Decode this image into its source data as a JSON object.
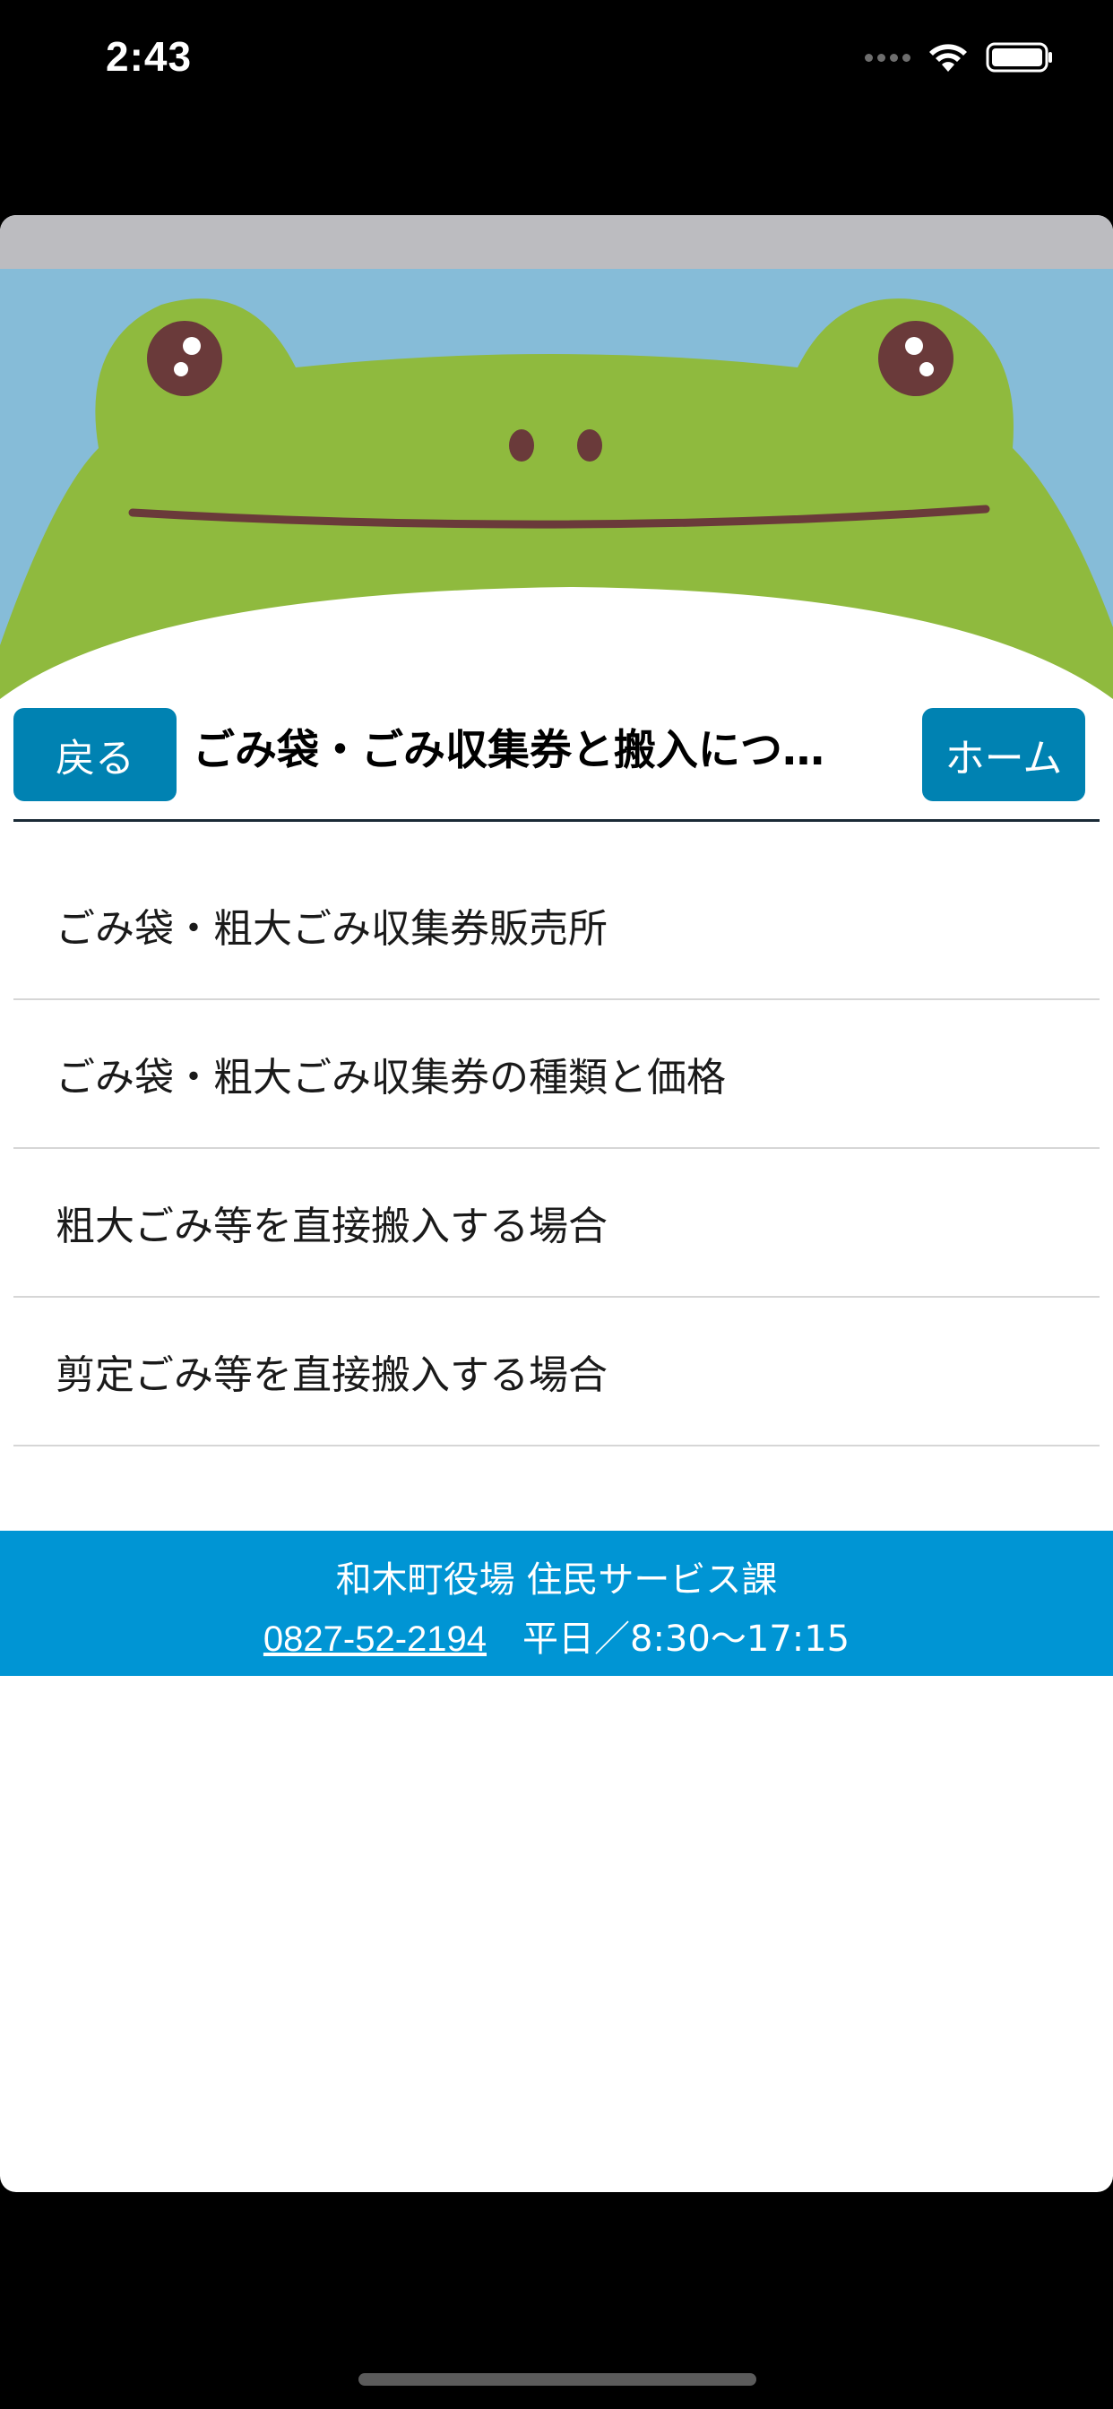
{
  "status_bar": {
    "time": "2:43",
    "wifi_icon": "wifi-icon",
    "battery_icon": "battery-icon"
  },
  "header": {
    "hero_image": "frog-face-illustration",
    "back_label": "戻る",
    "title": "ごみ袋・ごみ収集券と搬入につ…",
    "home_label": "ホーム"
  },
  "menu": {
    "items": [
      {
        "label": "ごみ袋・粗大ごみ収集券販売所"
      },
      {
        "label": "ごみ袋・粗大ごみ収集券の種類と価格"
      },
      {
        "label": "粗大ごみ等を直接搬入する場合"
      },
      {
        "label": "剪定ごみ等を直接搬入する場合"
      }
    ]
  },
  "footer": {
    "office": "和木町役場 住民サービス課",
    "phone": "0827-52-2194",
    "hours": "平日／8:30〜17:15"
  },
  "colors": {
    "button_blue": "#0082b2",
    "footer_blue": "#0095d4",
    "frog_green": "#8fba3e",
    "sky_blue": "#86bcd8"
  }
}
